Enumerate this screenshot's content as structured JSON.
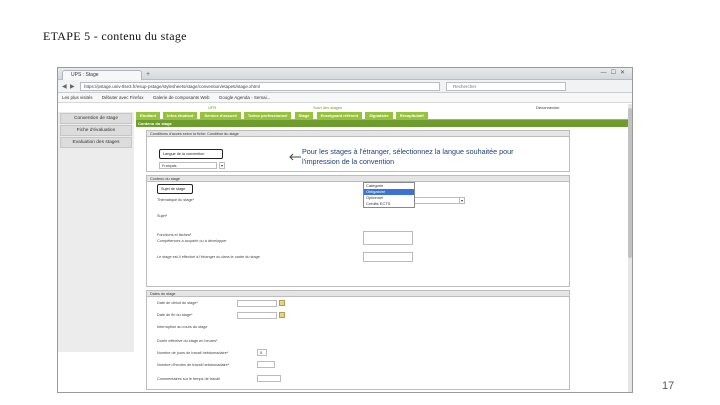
{
  "slide": {
    "title": "ETAPE 5 - contenu du stage",
    "page_number": "17"
  },
  "browser": {
    "tab_label": "UPS : Stage",
    "url": "https://pstage.univ-tlse3.fr/esup-pstage/stylesheets/stage/convention/etape5/stage.xhtml",
    "search_placeholder": "Rechercher",
    "bookmarks": [
      "Les plus visités",
      "Débuter avec Firefox",
      "Galerie de composants Web",
      "Google Agenda - Semai..."
    ]
  },
  "app": {
    "header_left": "UFR",
    "header_mid": "Suivi des stages",
    "header_right": "Déconnexion",
    "menu": [
      "Convention de stage",
      "Fiche d'évaluation",
      "Evaluation des stages"
    ],
    "tabs": [
      "Etudiant",
      "Infos étudiant",
      "Service d'accueil",
      "Tuteur professionnel",
      "Stage",
      "Enseignant référent",
      "Signataire",
      "Récapitulatif"
    ],
    "subtitle": "Contenu du stage",
    "section1_title": "Conditions d'accès selon la fiche: Condition du stage",
    "langue_label": "Langue de la convention",
    "langue_value": "Français",
    "section2_title": "Contenu du stage",
    "sujet_label": "Sujet de stage",
    "field_labels": [
      "Thématique du stage*",
      "Sujet*",
      "Fonctions et tâches*",
      "Compétences à acquérir ou à développer",
      "Le stage est-il effectué à l'étranger ou dans le cadre du stage"
    ],
    "dropdown_selected": "Catégorie",
    "dropdown_options": [
      "Catégorie",
      "Obligatoire",
      "Optionnel",
      "Crédits ECTS"
    ],
    "section3_title": "Dates du stage",
    "date_labels": [
      "Date de début du stage*",
      "Date de fin du stage*",
      "Interruption au cours du stage",
      "Durée effective du stage en heures*",
      "Nombre de jours de travail hebdomadaire*",
      "Nombre d'heures de travail hebdomadaire*",
      "Commentaires sur le temps de travail"
    ],
    "hours_value": "5"
  },
  "annotation": "Pour les stages à l'étranger, sélectionnez la langue souhaitée pour l'impression de la convention"
}
